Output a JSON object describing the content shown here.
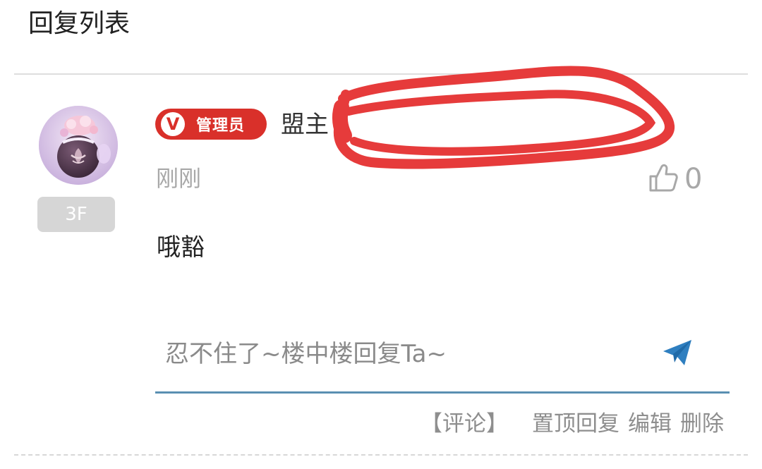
{
  "header": {
    "title": "回复列表"
  },
  "reply": {
    "floor": "3F",
    "role_badge": "管理员",
    "username": "盟主",
    "time": "刚刚",
    "like_count": "0",
    "content": "哦豁"
  },
  "reply_input": {
    "placeholder": "忍不住了~楼中楼回复Ta~"
  },
  "actions": {
    "comment": "【评论】",
    "pin": "置顶回复",
    "edit": "编辑",
    "delete": "删除"
  },
  "icons": {
    "like": "thumbs-up-icon",
    "send": "paper-plane-icon",
    "badge": "v-verified-icon"
  },
  "colors": {
    "badge_red": "#d9302a",
    "accent_blue": "#2f7fc0",
    "redaction_red": "#e63b3b",
    "muted_gray": "#a8a8a8"
  }
}
